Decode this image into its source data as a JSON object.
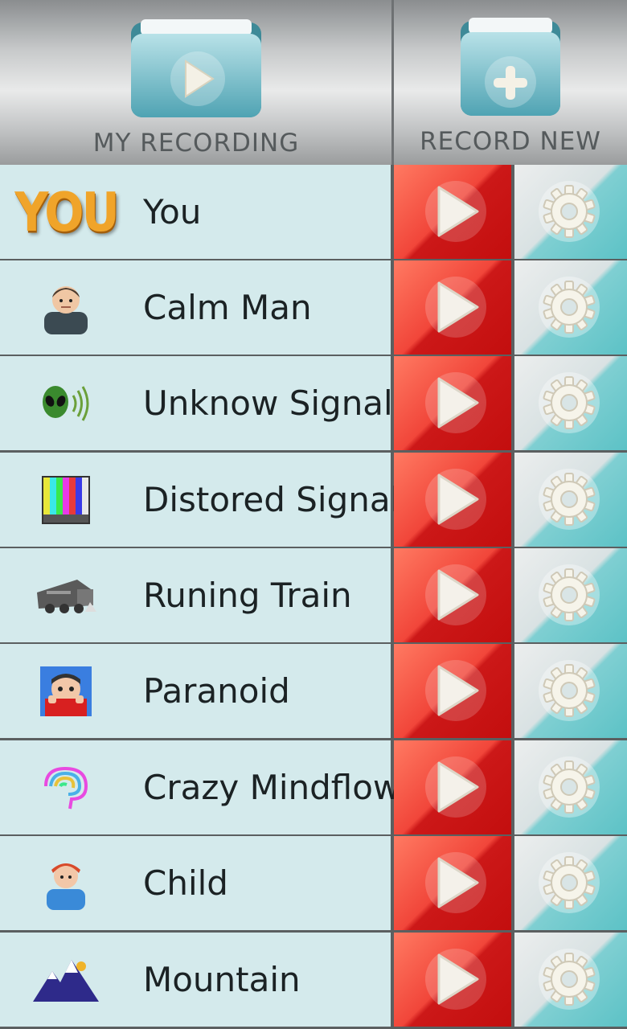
{
  "header": {
    "my_recording_label": "MY RECORDING",
    "record_new_label": "RECORD NEW"
  },
  "colors": {
    "row_background": "#d4eaec",
    "play_red": "#e02a22",
    "settings_teal": "#5cc2c6",
    "folder_teal": "#7cc6cf"
  },
  "items": [
    {
      "label": "You",
      "icon": "you-text-icon"
    },
    {
      "label": "Calm Man",
      "icon": "calm-man-icon"
    },
    {
      "label": "Unknow Signal",
      "icon": "alien-signal-icon"
    },
    {
      "label": "Distored Signal",
      "icon": "distorted-tv-icon"
    },
    {
      "label": "Runing Train",
      "icon": "train-icon"
    },
    {
      "label": "Paranoid",
      "icon": "paranoid-face-icon"
    },
    {
      "label": "Crazy Mindflow",
      "icon": "brain-icon"
    },
    {
      "label": "Child",
      "icon": "child-icon"
    },
    {
      "label": "Mountain",
      "icon": "mountain-icon"
    }
  ],
  "you_icon_text": "YOU"
}
